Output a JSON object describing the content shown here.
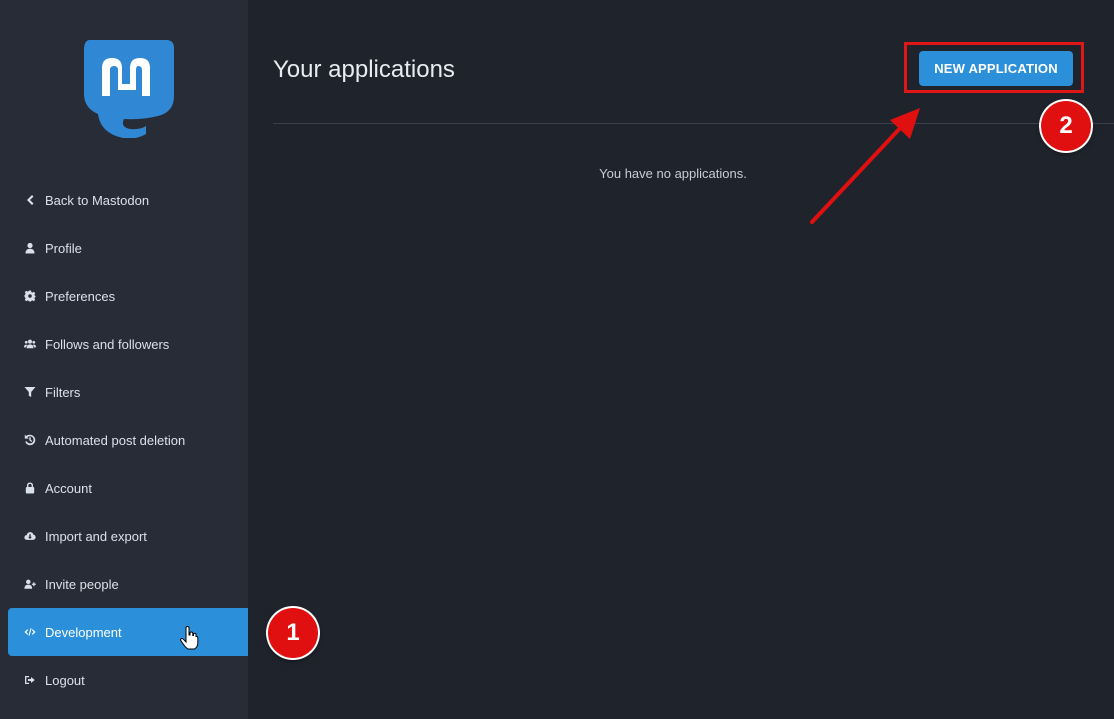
{
  "sidebar": {
    "logo_icon": "mastodon-logo",
    "items": [
      {
        "label": "Back to Mastodon",
        "icon": "chevron-left-icon"
      },
      {
        "label": "Profile",
        "icon": "user-icon"
      },
      {
        "label": "Preferences",
        "icon": "gear-icon"
      },
      {
        "label": "Follows and followers",
        "icon": "users-icon"
      },
      {
        "label": "Filters",
        "icon": "filter-icon"
      },
      {
        "label": "Automated post deletion",
        "icon": "history-icon"
      },
      {
        "label": "Account",
        "icon": "lock-icon"
      },
      {
        "label": "Import and export",
        "icon": "cloud-download-icon"
      },
      {
        "label": "Invite people",
        "icon": "user-plus-icon"
      },
      {
        "label": "Development",
        "icon": "code-icon",
        "active": true
      },
      {
        "label": "Logout",
        "icon": "sign-out-icon"
      }
    ]
  },
  "main": {
    "title": "Your applications",
    "new_button_label": "NEW APPLICATION",
    "empty_message": "You have no applications."
  },
  "annotations": {
    "badge_1": "1",
    "badge_2": "2",
    "color": "#e01010"
  },
  "colors": {
    "accent": "#2b90d9",
    "sidebar_bg": "#282c37",
    "main_bg": "#1f232b"
  }
}
